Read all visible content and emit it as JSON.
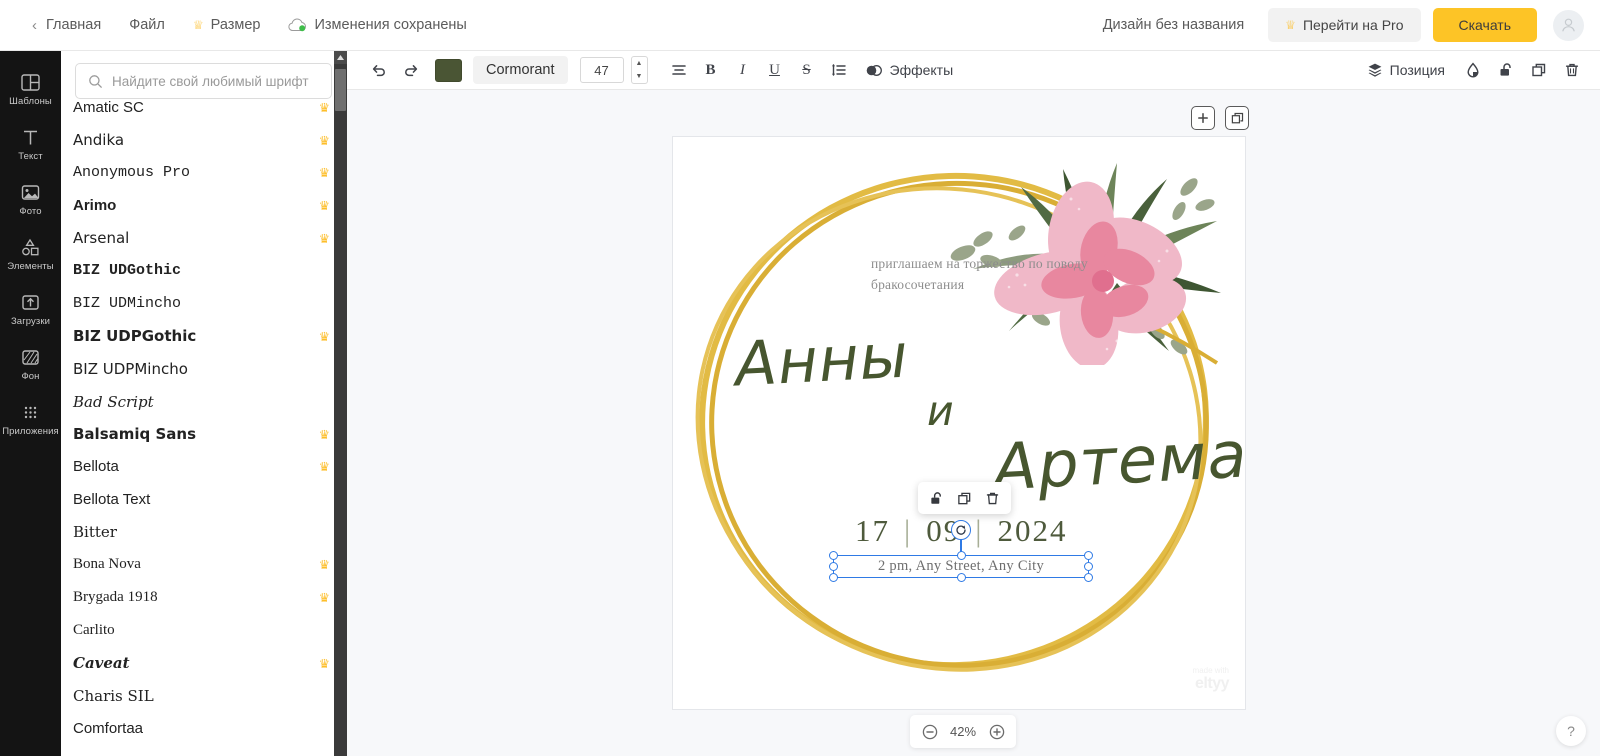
{
  "topbar": {
    "back_label": "Главная",
    "file_label": "Файл",
    "size_label": "Размер",
    "saved_label": "Изменения сохранены",
    "doc_title": "Дизайн без названия",
    "pro_label": "Перейти на Pro",
    "download_label": "Скачать"
  },
  "rail": {
    "items": [
      {
        "label": "Шаблоны",
        "icon": "templates-icon"
      },
      {
        "label": "Текст",
        "icon": "text-icon"
      },
      {
        "label": "Фото",
        "icon": "photo-icon"
      },
      {
        "label": "Элементы",
        "icon": "elements-icon"
      },
      {
        "label": "Загрузки",
        "icon": "uploads-icon"
      },
      {
        "label": "Фон",
        "icon": "background-icon"
      },
      {
        "label": "Приложения",
        "icon": "apps-icon"
      }
    ]
  },
  "panel": {
    "search_placeholder": "Найдите свой любимый шрифт",
    "search_value": "",
    "fonts": [
      {
        "name": "Amatic SC",
        "pro": true,
        "style": "f-sans"
      },
      {
        "name": "Andika",
        "pro": true,
        "style": "f-dvs"
      },
      {
        "name": "Anonymous Pro",
        "pro": true,
        "style": "f-mono"
      },
      {
        "name": "Arimo",
        "pro": true,
        "style": "f-sans f-bold"
      },
      {
        "name": "Arsenal",
        "pro": true,
        "style": "f-dvs"
      },
      {
        "name": "BIZ UDGothic",
        "pro": false,
        "style": "f-mono f-bold"
      },
      {
        "name": "BIZ UDMincho",
        "pro": false,
        "style": "f-mono"
      },
      {
        "name": "BIZ UDPGothic",
        "pro": true,
        "style": "f-dvs f-bold"
      },
      {
        "name": "BIZ UDPMincho",
        "pro": false,
        "style": "f-dvs"
      },
      {
        "name": "Bad Script",
        "pro": false,
        "style": "f-dvserif f-italic"
      },
      {
        "name": "Balsamiq Sans",
        "pro": true,
        "style": "f-dvs f-bold"
      },
      {
        "name": "Bellota",
        "pro": true,
        "style": "f-sans"
      },
      {
        "name": "Bellota Text",
        "pro": false,
        "style": "f-sans"
      },
      {
        "name": "Bitter",
        "pro": false,
        "style": "f-dvserif"
      },
      {
        "name": "Bona Nova",
        "pro": true,
        "style": "f-serif"
      },
      {
        "name": "Brygada 1918",
        "pro": true,
        "style": "f-serif"
      },
      {
        "name": "Carlito",
        "pro": false,
        "style": "f-serif"
      },
      {
        "name": "Caveat",
        "pro": true,
        "style": "f-dvserif f-italic f-bold"
      },
      {
        "name": "Charis SIL",
        "pro": false,
        "style": "f-dvserif"
      },
      {
        "name": "Comfortaa",
        "pro": false,
        "style": "f-sans"
      }
    ]
  },
  "toolbar": {
    "undo_label": "Отменить",
    "redo_label": "Повторить",
    "text_color": "#4a5534",
    "font_name": "Cormorant",
    "font_size": "47",
    "align_label": "Выравнивание",
    "bold_label": "B",
    "italic_label": "I",
    "underline_label": "U",
    "strike_label": "S",
    "spacing_label": "Интервал",
    "effects_label": "Эффекты",
    "position_label": "Позиция",
    "transparency_label": "Прозрачность",
    "lock_label": "Блокировка",
    "duplicate_label": "Дублировать",
    "delete_label": "Удалить"
  },
  "canvas": {
    "add_page_label": "+",
    "duplicate_page_label": "Дублировать страницу",
    "invite_text": "приглашаем на торжество по поводу бракосочетания",
    "name_bride": "Анны",
    "name_conj": "и",
    "name_groom": "Артема",
    "date": {
      "day": "17",
      "month": "09",
      "year": "2024",
      "separator": "|"
    },
    "venue": "2 pm, Any Street, Any City",
    "watermark_top": "made with",
    "watermark_bottom": "eltyy",
    "gold": "#e0b53b",
    "green": "#47562f",
    "flower_pink_light": "#f0b8c8",
    "flower_pink_dark": "#e8879f",
    "leaf_dark": "#3c5233",
    "leaf_sage": "#9aa58a"
  },
  "statusbar": {
    "zoom_out_label": "Уменьшить",
    "zoom_value": "42%",
    "zoom_in_label": "Увеличить",
    "help_label": "?"
  }
}
